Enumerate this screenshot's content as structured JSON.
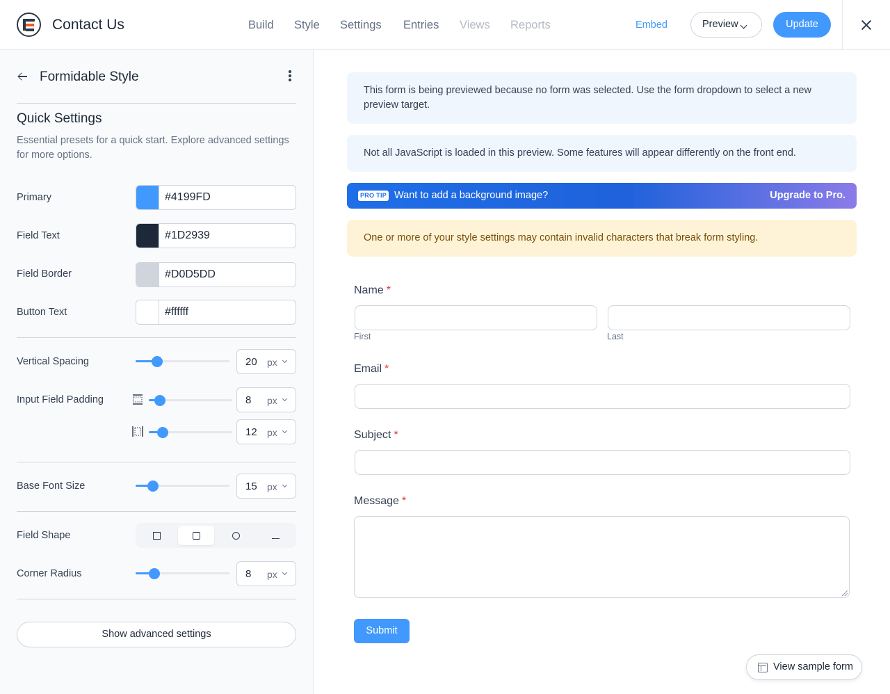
{
  "header": {
    "title": "Contact Us",
    "nav": [
      "Build",
      "Style",
      "Settings",
      "Entries",
      "Views",
      "Reports"
    ],
    "embed_label": "Embed",
    "preview_label": "Preview",
    "update_label": "Update"
  },
  "sidebar": {
    "style_name": "Formidable Style",
    "section_title": "Quick Settings",
    "section_desc": "Essential presets for a quick start. Explore advanced settings for more options.",
    "colors": [
      {
        "label": "Primary",
        "hex": "#4199FD",
        "swatch": "#4199FD"
      },
      {
        "label": "Field Text",
        "hex": "#1D2939",
        "swatch": "#1D2939"
      },
      {
        "label": "Field Border",
        "hex": "#D0D5DD",
        "swatch": "#D0D5DD"
      },
      {
        "label": "Button Text",
        "hex": "#ffffff",
        "swatch": "#ffffff"
      }
    ],
    "vertical_spacing": {
      "label": "Vertical Spacing",
      "value": "20",
      "unit": "px"
    },
    "input_padding": {
      "label": "Input Field Padding",
      "vertical": {
        "value": "8",
        "unit": "px"
      },
      "horizontal": {
        "value": "12",
        "unit": "px"
      }
    },
    "base_font_size": {
      "label": "Base Font Size",
      "value": "15",
      "unit": "px"
    },
    "field_shape": {
      "label": "Field Shape",
      "options": [
        "square",
        "rounded",
        "circle",
        "underline"
      ],
      "selected": "rounded"
    },
    "corner_radius": {
      "label": "Corner Radius",
      "value": "8",
      "unit": "px"
    },
    "advanced_label": "Show advanced settings"
  },
  "preview": {
    "notice_1": "This form is being previewed because no form was selected. Use the form dropdown to select a new preview target.",
    "notice_2": "Not all JavaScript is loaded in this preview. Some features will appear differently on the front end.",
    "protip": {
      "badge": "PRO TIP",
      "text": "Want to add a background image?",
      "link": "Upgrade to Pro."
    },
    "warning": "One or more of your style settings may contain invalid characters that break form styling.",
    "form": {
      "name_label": "Name",
      "first_label": "First",
      "last_label": "Last",
      "email_label": "Email",
      "subject_label": "Subject",
      "message_label": "Message",
      "required_mark": "*",
      "submit_label": "Submit"
    },
    "sample_label": "View sample form"
  },
  "colors": {
    "accent": "#4199FD",
    "text": "#1D2939",
    "border": "#D0D5DD",
    "required": "#e23636",
    "warning_bg": "#FEF3D7"
  }
}
